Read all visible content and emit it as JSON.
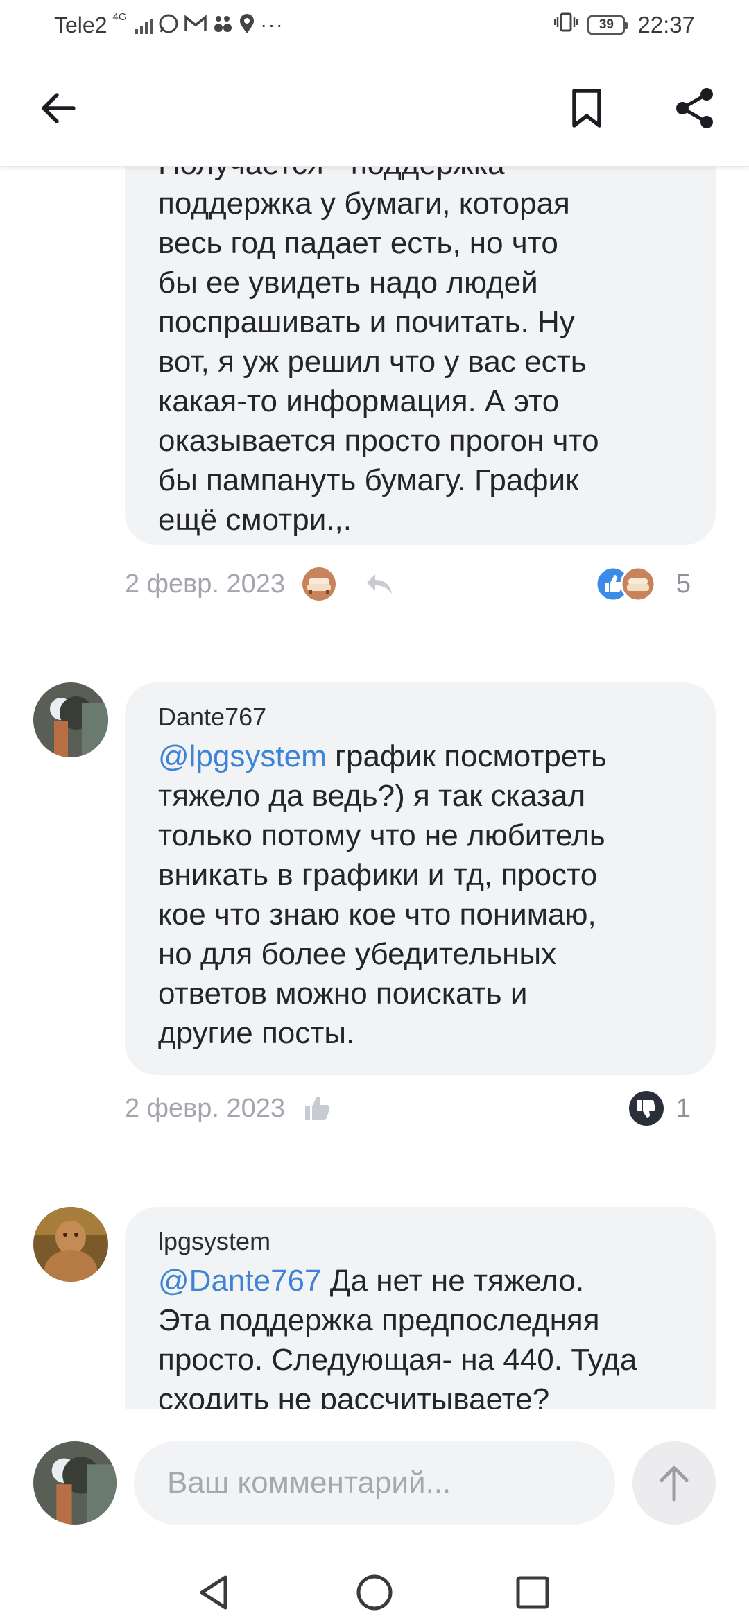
{
  "status_bar": {
    "carrier": "Tele2",
    "network": "4G",
    "battery": "39",
    "time": "22:37",
    "icons": [
      "whatsapp-icon",
      "gmail-icon",
      "paw-icon",
      "location-icon",
      "more-icon",
      "vibrate-icon"
    ]
  },
  "header": {
    "icons": [
      "back-arrow-icon",
      "bookmark-icon",
      "share-icon"
    ]
  },
  "comments": [
    {
      "text_partial_top": "Получается - поддержка",
      "text": "поддержка у бумаги, которая весь год падает есть, но что бы ее увидеть надо людей поспрашивать и почитать. Ну вот, я уж решил что у вас есть какая-то информация. А это оказывается просто прогон что бы пампануть бумагу. График ещё смотри.,.",
      "lines": [
        "поддержка у бумаги, которая",
        "весь год падает есть, но что",
        "бы ее увидеть надо людей",
        "поспрашивать и почитать. Ну",
        "вот, я уж решил что у вас есть",
        "какая-то информация. А это",
        "оказывается просто прогон что",
        "бы пампануть бумагу. График",
        "ещё смотри.,."
      ],
      "date": "2 февр. 2023",
      "reaction_count": "5"
    },
    {
      "author": "Dante767",
      "mention": "@lpgsystem",
      "first_line_rest": " график посмотреть",
      "lines": [
        "тяжело да ведь?) я так сказал",
        "только потому что не любитель",
        "вникать в графики и тд, просто",
        "кое что знаю кое что понимаю,",
        "но для более убедительных",
        "ответов можно поискать и",
        "другие посты."
      ],
      "date": "2 февр. 2023",
      "reaction_count": "1"
    },
    {
      "author": "lpgsystem",
      "mention": "@Dante767",
      "first_line_rest": " Да нет не тяжело.",
      "lines": [
        "Эта поддержка предпоследняя",
        "просто. Следующая- на 440. Туда",
        "сходить не рассчитываете?"
      ]
    }
  ],
  "composer": {
    "placeholder": "Ваш комментарий..."
  },
  "colors": {
    "mention": "#3d84d6",
    "bubble": "#f2f3f5",
    "date": "#a3a6ad",
    "like_blue": "#3c8ce7",
    "dislike_dark": "#2b2f3a",
    "couch_orange": "#c9835a"
  }
}
